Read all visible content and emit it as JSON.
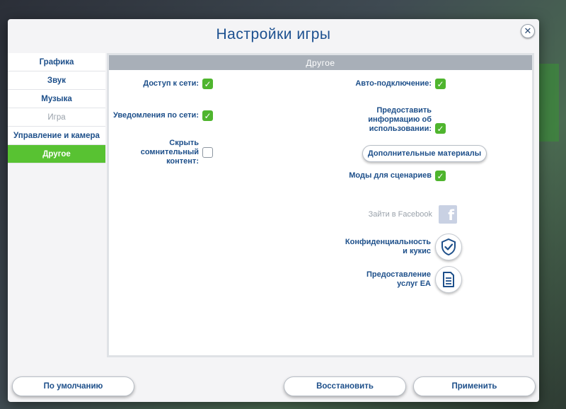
{
  "dialog": {
    "title": "Настройки игры",
    "close_label": "✕"
  },
  "sidebar": {
    "items": [
      {
        "label": "Графика"
      },
      {
        "label": "Звук"
      },
      {
        "label": "Музыка"
      },
      {
        "label": "Игра"
      },
      {
        "label": "Управление и камера"
      },
      {
        "label": "Другое"
      }
    ]
  },
  "panel": {
    "header": "Другое",
    "left_options": [
      {
        "label": "Доступ к сети:",
        "checked": true
      },
      {
        "label": "Уведомления по сети:",
        "checked": true
      },
      {
        "label": "Скрыть\nсомнительный\nконтент:",
        "checked": false
      }
    ],
    "right_options": [
      {
        "label": "Авто-подключение:",
        "checked": true
      },
      {
        "label": "Предоставить\nинформацию об\nиспользовании:",
        "checked": true
      },
      {
        "label": "Моды для сценариев",
        "checked": true
      }
    ],
    "extra_materials_button": "Дополнительные материалы",
    "facebook_label": "Зайти в Facebook",
    "facebook_glyph": "f",
    "privacy_label": "Конфиденциальность\nи кукис",
    "ea_services_label": "Предоставление\nуслуг EA"
  },
  "footer": {
    "default_button": "По умолчанию",
    "restore_button": "Восстановить",
    "apply_button": "Применить"
  },
  "colors": {
    "accent_green": "#58c232",
    "text_blue": "#1d4f8a",
    "header_gray": "#a8afb8"
  },
  "icons": {
    "check": "check-icon",
    "facebook": "facebook-icon",
    "privacy": "shield-check-icon",
    "ea_services": "document-icon",
    "close": "close-icon"
  }
}
